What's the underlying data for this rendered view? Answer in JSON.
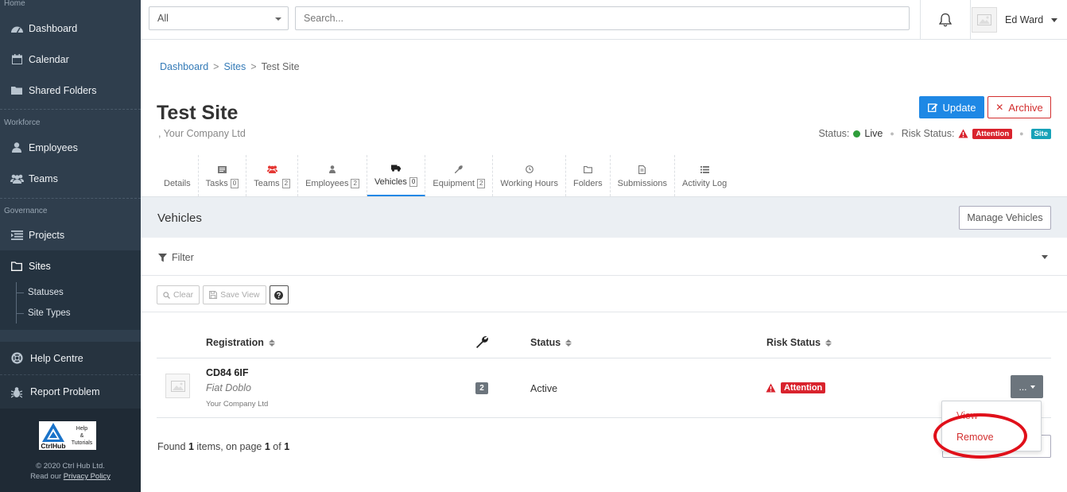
{
  "colors": {
    "sidebar_bg": "#2f3e4d",
    "primary": "#1e88e5",
    "danger": "#d32f2f",
    "success": "#2e9d3a",
    "info": "#17a2b8",
    "annotation_ring": "#e0101a"
  },
  "sidebar": {
    "sections": {
      "home": "Home",
      "workforce": "Workforce",
      "governance": "Governance"
    },
    "items": {
      "dashboard": "Dashboard",
      "calendar": "Calendar",
      "shared_folders": "Shared Folders",
      "employees": "Employees",
      "teams": "Teams",
      "projects": "Projects",
      "sites": "Sites",
      "statuses": "Statuses",
      "site_types": "Site Types"
    },
    "bottom": {
      "help_centre": "Help Centre",
      "report_problem": "Report Problem"
    },
    "footer": {
      "logo_text": "CtrlHub",
      "logo_side": [
        "Help",
        "&",
        "Tutorials"
      ],
      "copyright": "© 2020 Ctrl Hub Ltd.",
      "read_our": "Read our",
      "privacy": "Privacy Policy"
    }
  },
  "topbar": {
    "scope_select": "All",
    "search_placeholder": "Search...",
    "user_name": "Ed Ward"
  },
  "breadcrumb": [
    "Dashboard",
    "Sites",
    "Test Site"
  ],
  "page": {
    "title": "Test Site",
    "subtitle": ", Your Company Ltd",
    "update_label": "Update",
    "archive_label": "Archive",
    "status_label": "Status:",
    "status_value": "Live",
    "risk_label": "Risk Status:",
    "risk_value": "Attention",
    "type_badge": "Site"
  },
  "tabs": [
    {
      "label": "Details",
      "icon": "none",
      "count": null
    },
    {
      "label": "Tasks",
      "icon": "tasks-icon",
      "count": "0"
    },
    {
      "label": "Teams",
      "icon": "teams-icon",
      "count": "2"
    },
    {
      "label": "Employees",
      "icon": "employee-icon",
      "count": "2"
    },
    {
      "label": "Vehicles",
      "icon": "truck-icon",
      "count": "0"
    },
    {
      "label": "Equipment",
      "icon": "wrench-icon",
      "count": "2"
    },
    {
      "label": "Working Hours",
      "icon": "clock-icon",
      "count": null
    },
    {
      "label": "Folders",
      "icon": "folder-icon",
      "count": null
    },
    {
      "label": "Submissions",
      "icon": "file-icon",
      "count": null
    },
    {
      "label": "Activity Log",
      "icon": "list-icon",
      "count": null
    }
  ],
  "section": {
    "title": "Vehicles",
    "manage_label": "Manage Vehicles",
    "filter_label": "Filter",
    "clear_label": "Clear",
    "save_view_label": "Save View"
  },
  "table": {
    "headers": {
      "registration": "Registration",
      "status": "Status",
      "risk_status": "Risk Status"
    },
    "rows": [
      {
        "registration": "CD84 6IF",
        "model": "Fiat Doblo",
        "company": "Your Company Ltd",
        "equipment_count": "2",
        "status": "Active",
        "risk": "Attention",
        "more_label": "..."
      }
    ]
  },
  "pagination": {
    "found": "Found",
    "count": "1",
    "items_on_page": "items, on page",
    "page": "1",
    "of": "of",
    "total": "1"
  },
  "row_menu": {
    "view": "View",
    "remove": "Remove"
  }
}
